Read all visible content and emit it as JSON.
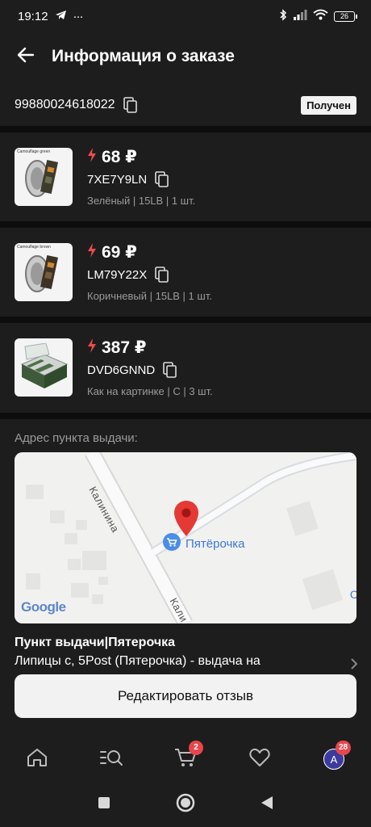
{
  "status_bar": {
    "time": "19:12",
    "more": "···",
    "battery": "26"
  },
  "header": {
    "title": "Информация о заказе"
  },
  "order": {
    "id": "99880024618022",
    "status": "Получен"
  },
  "items": [
    {
      "price": "68 ₽",
      "sku": "7XE7Y9LN",
      "meta": "Зелёный | 15LB | 1 шт.",
      "thumb_label": "Camouflage green"
    },
    {
      "price": "69 ₽",
      "sku": "LM79Y22X",
      "meta": "Коричневый | 15LB | 1 шт.",
      "thumb_label": "Camouflage brown"
    },
    {
      "price": "387 ₽",
      "sku": "DVD6GNND",
      "meta": "Как на картинке | C | 3 шт.",
      "thumb_label": ""
    }
  ],
  "pickup": {
    "label": "Адрес пункта выдачи:",
    "title": "Пункт выдачи|Пятерочка",
    "address": "Липицы с, 5Post (Пятерочка) - выдача на"
  },
  "map": {
    "street_1": "Калинина",
    "street_2": "Кали",
    "place": "Пятёрочка",
    "edge_letter": "С",
    "logo": "Google"
  },
  "actions": {
    "review_label": "Редактировать отзыв"
  },
  "nav": {
    "cart_badge": "2",
    "profile_badge": "28",
    "avatar_letter": "A"
  },
  "colors": {
    "background": "#1d1d1d",
    "accent_red": "#e8464c",
    "lightning": "#ef4b4b",
    "map_pin": "#e53935",
    "map_label": "#3b78d8"
  }
}
